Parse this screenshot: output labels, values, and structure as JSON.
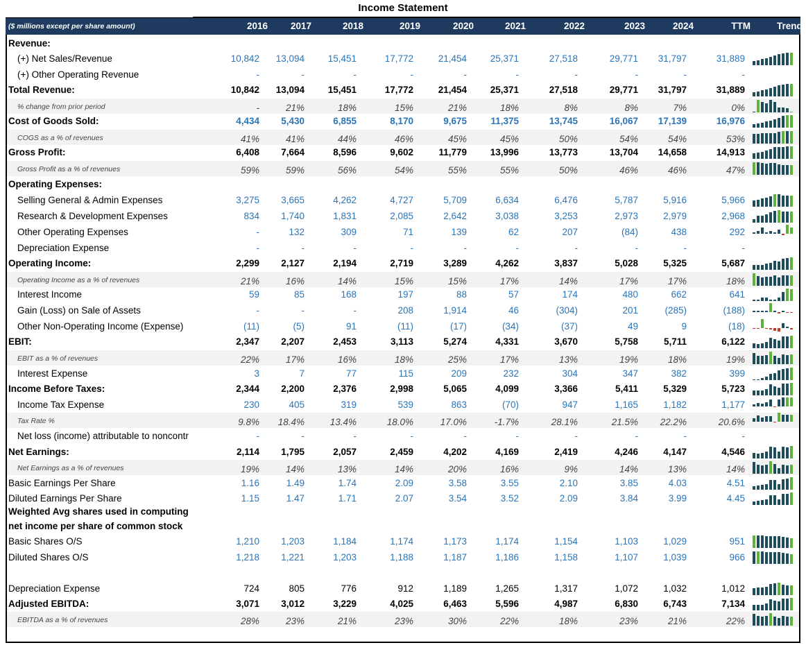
{
  "title": "Income Statement",
  "units_label": "($ millions except per share amount)",
  "years": [
    "2016",
    "2017",
    "2018",
    "2019",
    "2020",
    "2021",
    "2022",
    "2023",
    "2024",
    "TTM"
  ],
  "trend_label": "Trend",
  "colors": {
    "header_bg": "#1f3a5f",
    "value_blue": "#2a74b8",
    "spark_dark": "#1e4d5c",
    "spark_green": "#5fb33a",
    "spark_red": "#c0392b"
  },
  "rows": [
    {
      "label": "Revenue:",
      "type": "section",
      "values": []
    },
    {
      "label": "(+) Net Sales/Revenue",
      "type": "item",
      "values": [
        "10,842",
        "13,094",
        "15,451",
        "17,772",
        "21,454",
        "25,371",
        "27,518",
        "29,771",
        "31,797",
        "31,889"
      ],
      "trend": [
        10842,
        13094,
        15451,
        17772,
        21454,
        25371,
        27518,
        29771,
        31797,
        31889
      ]
    },
    {
      "label": "(+) Other Operating Revenue",
      "type": "item",
      "values": [
        "-",
        "-",
        "-",
        "-",
        "-",
        "-",
        "-",
        "-",
        "-",
        "-"
      ]
    },
    {
      "label": "Total Revenue:",
      "type": "total",
      "values": [
        "10,842",
        "13,094",
        "15,451",
        "17,772",
        "21,454",
        "25,371",
        "27,518",
        "29,771",
        "31,797",
        "31,889"
      ],
      "trend": [
        10842,
        13094,
        15451,
        17772,
        21454,
        25371,
        27518,
        29771,
        31797,
        31889
      ]
    },
    {
      "label": "% change from prior period",
      "type": "pct",
      "values": [
        "-",
        "21%",
        "18%",
        "15%",
        "21%",
        "18%",
        "8%",
        "8%",
        "7%",
        "0%"
      ],
      "trend": [
        0,
        21,
        18,
        15,
        21,
        18,
        8,
        8,
        7,
        0
      ]
    },
    {
      "label": "Cost of Goods Sold:",
      "type": "totalblue",
      "values": [
        "4,434",
        "5,430",
        "6,855",
        "8,170",
        "9,675",
        "11,375",
        "13,745",
        "16,067",
        "17,139",
        "16,976"
      ],
      "trend": [
        4434,
        5430,
        6855,
        8170,
        9675,
        11375,
        13745,
        16067,
        17139,
        16976
      ]
    },
    {
      "label": "COGS as a % of revenues",
      "type": "pct",
      "values": [
        "41%",
        "41%",
        "44%",
        "46%",
        "45%",
        "45%",
        "50%",
        "54%",
        "54%",
        "53%"
      ],
      "trend": [
        41,
        41,
        44,
        46,
        45,
        45,
        50,
        54,
        54,
        53
      ]
    },
    {
      "label": "Gross Profit:",
      "type": "total",
      "values": [
        "6,408",
        "7,664",
        "8,596",
        "9,602",
        "11,779",
        "13,996",
        "13,773",
        "13,704",
        "14,658",
        "14,913"
      ],
      "trend": [
        6408,
        7664,
        8596,
        9602,
        11779,
        13996,
        13773,
        13704,
        14658,
        14913
      ]
    },
    {
      "label": "Gross Profit as a % of revenues",
      "type": "pct",
      "values": [
        "59%",
        "59%",
        "56%",
        "54%",
        "55%",
        "55%",
        "50%",
        "46%",
        "46%",
        "47%"
      ],
      "trend": [
        59,
        59,
        56,
        54,
        55,
        55,
        50,
        46,
        46,
        47
      ]
    },
    {
      "label": "Operating Expenses:",
      "type": "section",
      "values": []
    },
    {
      "label": "Selling General & Admin Expenses",
      "type": "item",
      "values": [
        "3,275",
        "3,665",
        "4,262",
        "4,727",
        "5,709",
        "6,634",
        "6,476",
        "5,787",
        "5,916",
        "5,966"
      ],
      "trend": [
        3275,
        3665,
        4262,
        4727,
        5709,
        6634,
        6476,
        5787,
        5916,
        5966
      ]
    },
    {
      "label": "Research & Development Expenses",
      "type": "item",
      "values": [
        "834",
        "1,740",
        "1,831",
        "2,085",
        "2,642",
        "3,038",
        "3,253",
        "2,973",
        "2,979",
        "2,968"
      ],
      "trend": [
        834,
        1740,
        1831,
        2085,
        2642,
        3038,
        3253,
        2973,
        2979,
        2968
      ]
    },
    {
      "label": "Other Operating Expenses",
      "type": "item",
      "values": [
        "-",
        "132",
        "309",
        "71",
        "139",
        "62",
        "207",
        "(84)",
        "438",
        "292"
      ],
      "trend": [
        0,
        132,
        309,
        71,
        139,
        62,
        207,
        -84,
        438,
        292
      ]
    },
    {
      "label": "Depreciation Expense",
      "type": "item",
      "values": [
        "-",
        "-",
        "-",
        "-",
        "-",
        "-",
        "-",
        "-",
        "-",
        "-"
      ]
    },
    {
      "label": "Operating Income:",
      "type": "total",
      "values": [
        "2,299",
        "2,127",
        "2,194",
        "2,719",
        "3,289",
        "4,262",
        "3,837",
        "5,028",
        "5,325",
        "5,687"
      ],
      "trend": [
        2299,
        2127,
        2194,
        2719,
        3289,
        4262,
        3837,
        5028,
        5325,
        5687
      ]
    },
    {
      "label": "Operating Income as a % of revenues",
      "type": "pct",
      "values": [
        "21%",
        "16%",
        "14%",
        "15%",
        "15%",
        "17%",
        "14%",
        "17%",
        "17%",
        "18%"
      ],
      "trend": [
        21,
        16,
        14,
        15,
        15,
        17,
        14,
        17,
        17,
        18
      ]
    },
    {
      "label": "Interest Income",
      "type": "item",
      "values": [
        "59",
        "85",
        "168",
        "197",
        "88",
        "57",
        "174",
        "480",
        "662",
        "641"
      ],
      "trend": [
        59,
        85,
        168,
        197,
        88,
        57,
        174,
        480,
        662,
        641
      ]
    },
    {
      "label": "Gain (Loss) on Sale of Assets",
      "type": "item",
      "values": [
        "-",
        "-",
        "-",
        "208",
        "1,914",
        "46",
        "(304)",
        "201",
        "(285)",
        "(188)"
      ],
      "trend": [
        0,
        0,
        0,
        208,
        1914,
        46,
        -304,
        201,
        -285,
        -188
      ]
    },
    {
      "label": "Other Non-Operating Income (Expense)",
      "type": "item",
      "values": [
        "(11)",
        "(5)",
        "91",
        "(11)",
        "(17)",
        "(34)",
        "(37)",
        "49",
        "9",
        "(18)"
      ],
      "trend": [
        -11,
        -5,
        91,
        -11,
        -17,
        -34,
        -37,
        49,
        9,
        -18
      ]
    },
    {
      "label": "EBIT:",
      "type": "total",
      "values": [
        "2,347",
        "2,207",
        "2,453",
        "3,113",
        "5,274",
        "4,331",
        "3,670",
        "5,758",
        "5,711",
        "6,122"
      ],
      "trend": [
        2347,
        2207,
        2453,
        3113,
        5274,
        4331,
        3670,
        5758,
        5711,
        6122
      ]
    },
    {
      "label": "EBIT as a % of revenues",
      "type": "pct",
      "values": [
        "22%",
        "17%",
        "16%",
        "18%",
        "25%",
        "17%",
        "13%",
        "19%",
        "18%",
        "19%"
      ],
      "trend": [
        22,
        17,
        16,
        18,
        25,
        17,
        13,
        19,
        18,
        19
      ]
    },
    {
      "label": "Interest Expense",
      "type": "item",
      "values": [
        "3",
        "7",
        "77",
        "115",
        "209",
        "232",
        "304",
        "347",
        "382",
        "399"
      ],
      "trend": [
        3,
        7,
        77,
        115,
        209,
        232,
        304,
        347,
        382,
        399
      ]
    },
    {
      "label": "Income Before Taxes:",
      "type": "total",
      "values": [
        "2,344",
        "2,200",
        "2,376",
        "2,998",
        "5,065",
        "4,099",
        "3,366",
        "5,411",
        "5,329",
        "5,723"
      ],
      "trend": [
        2344,
        2200,
        2376,
        2998,
        5065,
        4099,
        3366,
        5411,
        5329,
        5723
      ]
    },
    {
      "label": "Income Tax Expense",
      "type": "item",
      "values": [
        "230",
        "405",
        "319",
        "539",
        "863",
        "(70)",
        "947",
        "1,165",
        "1,182",
        "1,177"
      ],
      "trend": [
        230,
        405,
        319,
        539,
        863,
        -70,
        947,
        1165,
        1182,
        1177
      ]
    },
    {
      "label": "Tax Rate %",
      "type": "pct",
      "values": [
        "9.8%",
        "18.4%",
        "13.4%",
        "18.0%",
        "17.0%",
        "-1.7%",
        "28.1%",
        "21.5%",
        "22.2%",
        "20.6%"
      ],
      "trend": [
        9.8,
        18.4,
        13.4,
        18.0,
        17.0,
        -1.7,
        28.1,
        21.5,
        22.2,
        20.6
      ]
    },
    {
      "label": "Net loss (income) attributable to noncontr",
      "type": "item",
      "values": [
        "-",
        "-",
        "-",
        "-",
        "-",
        "-",
        "-",
        "-",
        "-",
        "-"
      ]
    },
    {
      "label": "Net Earnings:",
      "type": "total",
      "values": [
        "2,114",
        "1,795",
        "2,057",
        "2,459",
        "4,202",
        "4,169",
        "2,419",
        "4,246",
        "4,147",
        "4,546"
      ],
      "trend": [
        2114,
        1795,
        2057,
        2459,
        4202,
        4169,
        2419,
        4246,
        4147,
        4546
      ]
    },
    {
      "label": "Net Earnings as a % of revenues",
      "type": "pct",
      "values": [
        "19%",
        "14%",
        "13%",
        "14%",
        "20%",
        "16%",
        "9%",
        "14%",
        "13%",
        "14%"
      ],
      "trend": [
        19,
        14,
        13,
        14,
        20,
        16,
        9,
        14,
        13,
        14
      ]
    },
    {
      "label": "Basic Earnings Per Share",
      "type": "itemflush",
      "values": [
        "1.16",
        "1.49",
        "1.74",
        "2.09",
        "3.58",
        "3.55",
        "2.10",
        "3.85",
        "4.03",
        "4.51"
      ],
      "trend": [
        1.16,
        1.49,
        1.74,
        2.09,
        3.58,
        3.55,
        2.1,
        3.85,
        4.03,
        4.51
      ]
    },
    {
      "label": "Diluted Earnings Per Share",
      "type": "itemflush",
      "values": [
        "1.15",
        "1.47",
        "1.71",
        "2.07",
        "3.54",
        "3.52",
        "2.09",
        "3.84",
        "3.99",
        "4.45"
      ],
      "trend": [
        1.15,
        1.47,
        1.71,
        2.07,
        3.54,
        3.52,
        2.09,
        3.84,
        3.99,
        4.45
      ]
    },
    {
      "label": "Weighted Avg shares used in computing",
      "type": "section",
      "values": []
    },
    {
      "label": "net income per share of common stock",
      "type": "section",
      "values": []
    },
    {
      "label": "Basic Shares O/S",
      "type": "itemflush",
      "values": [
        "1,210",
        "1,203",
        "1,184",
        "1,174",
        "1,173",
        "1,174",
        "1,154",
        "1,103",
        "1,029",
        "951"
      ],
      "trend": [
        1210,
        1203,
        1184,
        1174,
        1173,
        1174,
        1154,
        1103,
        1029,
        951
      ]
    },
    {
      "label": "Diluted Shares O/S",
      "type": "itemflush",
      "values": [
        "1,218",
        "1,221",
        "1,203",
        "1,188",
        "1,187",
        "1,186",
        "1,158",
        "1,107",
        "1,039",
        "966"
      ],
      "trend": [
        1218,
        1221,
        1203,
        1188,
        1187,
        1186,
        1158,
        1107,
        1039,
        966
      ]
    },
    {
      "label": "",
      "type": "blank",
      "values": []
    },
    {
      "label": "Depreciation Expense",
      "type": "black",
      "values": [
        "724",
        "805",
        "776",
        "912",
        "1,189",
        "1,265",
        "1,317",
        "1,072",
        "1,032",
        "1,012"
      ],
      "trend": [
        724,
        805,
        776,
        912,
        1189,
        1265,
        1317,
        1072,
        1032,
        1012
      ]
    },
    {
      "label": "Adjusted EBITDA:",
      "type": "total",
      "values": [
        "3,071",
        "3,012",
        "3,229",
        "4,025",
        "6,463",
        "5,596",
        "4,987",
        "6,830",
        "6,743",
        "7,134"
      ],
      "trend": [
        3071,
        3012,
        3229,
        4025,
        6463,
        5596,
        4987,
        6830,
        6743,
        7134
      ]
    },
    {
      "label": "EBITDA as a % of revenues",
      "type": "pct",
      "values": [
        "28%",
        "23%",
        "21%",
        "23%",
        "30%",
        "22%",
        "18%",
        "23%",
        "21%",
        "22%"
      ],
      "trend": [
        28,
        23,
        21,
        23,
        30,
        22,
        18,
        23,
        21,
        22
      ]
    }
  ]
}
